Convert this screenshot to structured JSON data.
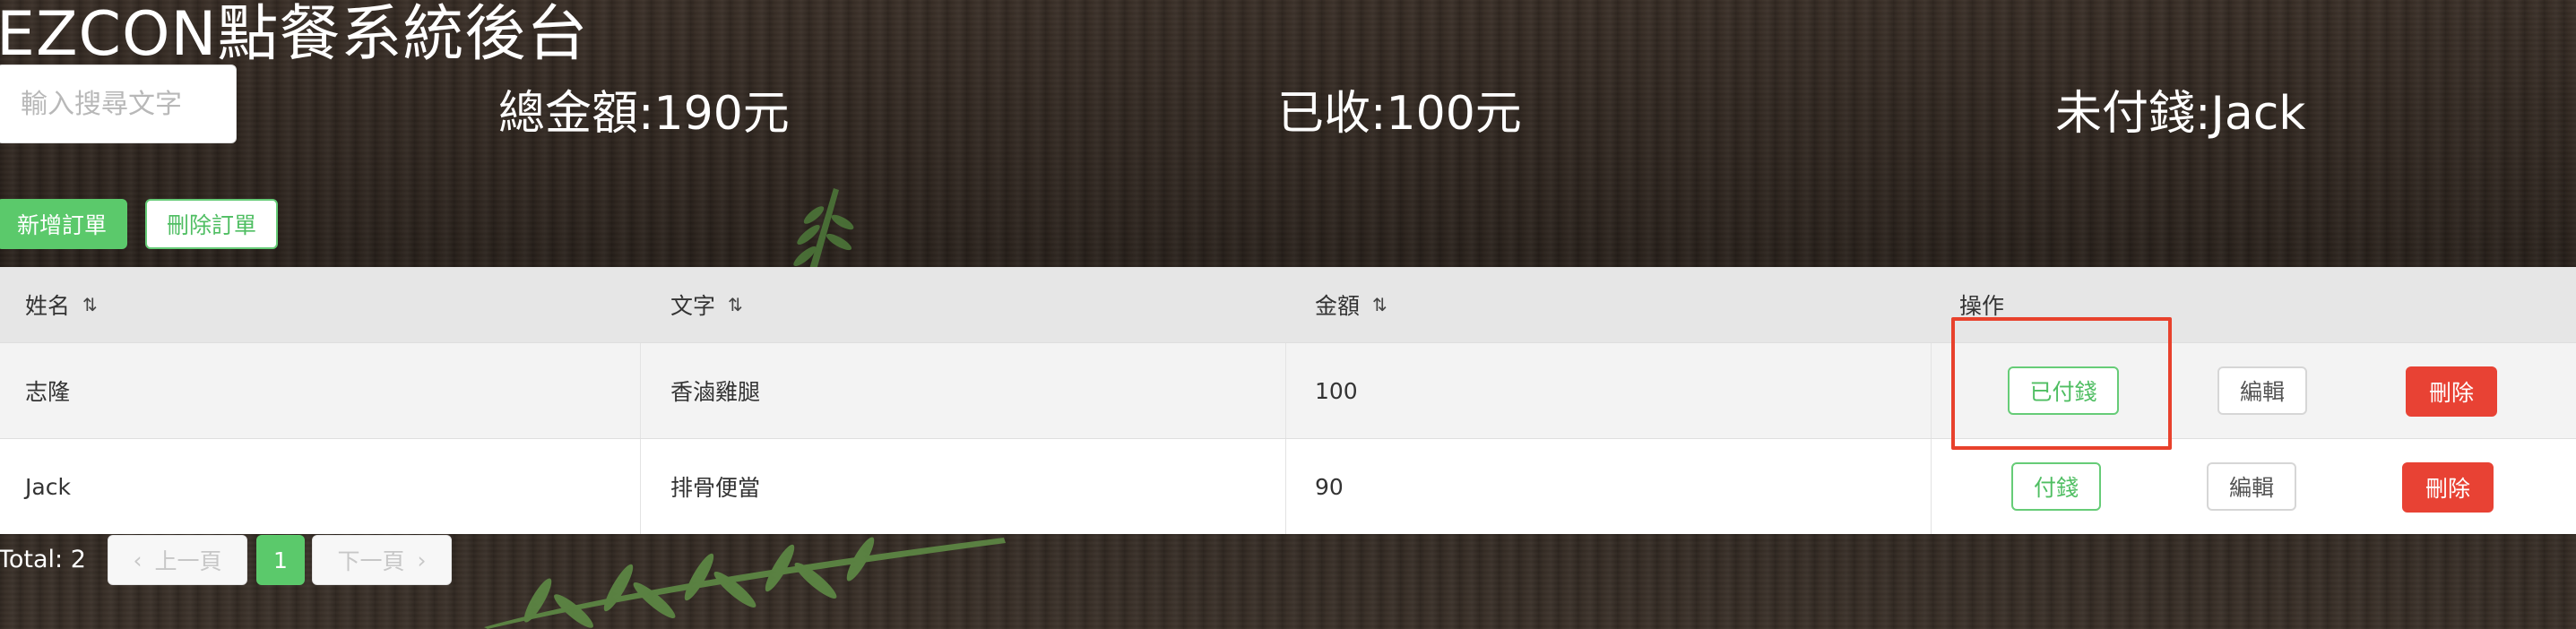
{
  "header": {
    "title": "EZCON點餐系統後台"
  },
  "search": {
    "placeholder": "輸入搜尋文字"
  },
  "stats": {
    "total": "總金額:190元",
    "received": "已收:100元",
    "unpaid": "未付錢:Jack"
  },
  "toolbar": {
    "add_label": "新增訂單",
    "delete_label": "刪除訂單"
  },
  "table": {
    "columns": [
      "姓名",
      "文字",
      "金額",
      "操作"
    ],
    "rows": [
      {
        "name": "志隆",
        "text": "香滷雞腿",
        "amount": "100",
        "pay": "已付錢",
        "edit": "編輯",
        "delete": "刪除"
      },
      {
        "name": "Jack",
        "text": "排骨便當",
        "amount": "90",
        "pay": "付錢",
        "edit": "編輯",
        "delete": "刪除"
      }
    ]
  },
  "pagination": {
    "total": "Total: 2",
    "prev": "上一頁",
    "page": "1",
    "next": "下一頁"
  },
  "colors": {
    "accent_green": "#5bc96b",
    "danger_red": "#e84234",
    "highlight_box": "#e8412c"
  }
}
